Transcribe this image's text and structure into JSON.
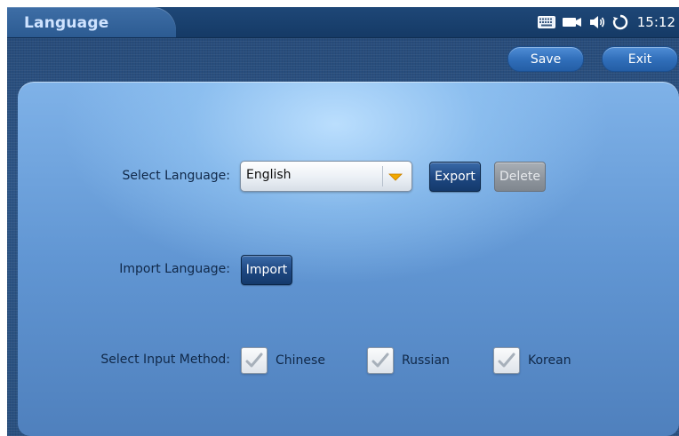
{
  "header": {
    "title": "Language",
    "clock": "15:12",
    "status_icons": [
      "keyboard-icon",
      "camera-icon",
      "speaker-icon",
      "sync-icon"
    ]
  },
  "toolbar": {
    "save_label": "Save",
    "exit_label": "Exit"
  },
  "form": {
    "select_language": {
      "label": "Select Language:",
      "value": "English",
      "export_label": "Export",
      "delete_label": "Delete"
    },
    "import_language": {
      "label": "Import Language:",
      "import_label": "Import"
    },
    "input_method": {
      "label": "Select Input Method:",
      "options": [
        {
          "label": "Chinese",
          "checked": true
        },
        {
          "label": "Russian",
          "checked": true
        },
        {
          "label": "Korean",
          "checked": true
        }
      ]
    }
  },
  "colors": {
    "accent": "#2f6db8",
    "panel": "#6196d3",
    "dark_button": "#1d4680",
    "disabled_button": "#8d949c",
    "arrow": "#f2a900"
  }
}
